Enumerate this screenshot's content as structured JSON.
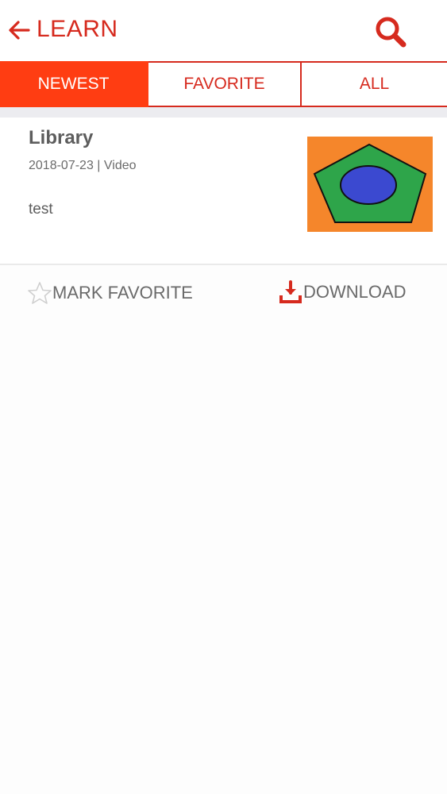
{
  "header": {
    "title": "LEARN"
  },
  "tabs": [
    {
      "label": "NEWEST",
      "active": true
    },
    {
      "label": "FAVORITE",
      "active": false
    },
    {
      "label": "ALL",
      "active": false
    }
  ],
  "item": {
    "title": "Library",
    "meta": "2018-07-23  | Video",
    "description": "test"
  },
  "actions": {
    "favorite_label": "MARK FAVORITE",
    "download_label": "DOWNLOAD"
  },
  "colors": {
    "accent": "#d62a1e",
    "active_tab": "#ff3d12"
  },
  "icons": {
    "back": "arrow-left-icon",
    "search": "search-icon",
    "favorite": "star-outline-icon",
    "download": "download-icon"
  }
}
